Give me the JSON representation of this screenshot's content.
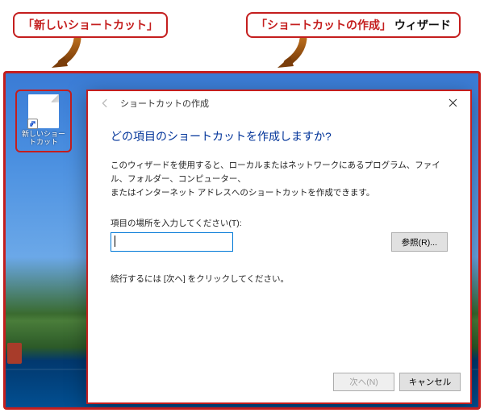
{
  "labels": {
    "left": "「新しいショートカット」",
    "right_red": "「ショートカットの作成」",
    "right_suffix": " ウィザード"
  },
  "desktop": {
    "shortcut_name": "新しいショートカット"
  },
  "wizard": {
    "title": "ショートカットの作成",
    "heading": "どの項目のショートカットを作成しますか?",
    "description_line1": "このウィザードを使用すると、ローカルまたはネットワークにあるプログラム、ファイル、フォルダー、コンピューター、",
    "description_line2": "またはインターネット アドレスへのショートカットを作成できます。",
    "field_label": "項目の場所を入力してください(T):",
    "field_value": "",
    "browse_label": "参照(R)...",
    "hint": "続行するには [次へ] をクリックしてください。",
    "next_label": "次へ(N)",
    "cancel_label": "キャンセル"
  }
}
